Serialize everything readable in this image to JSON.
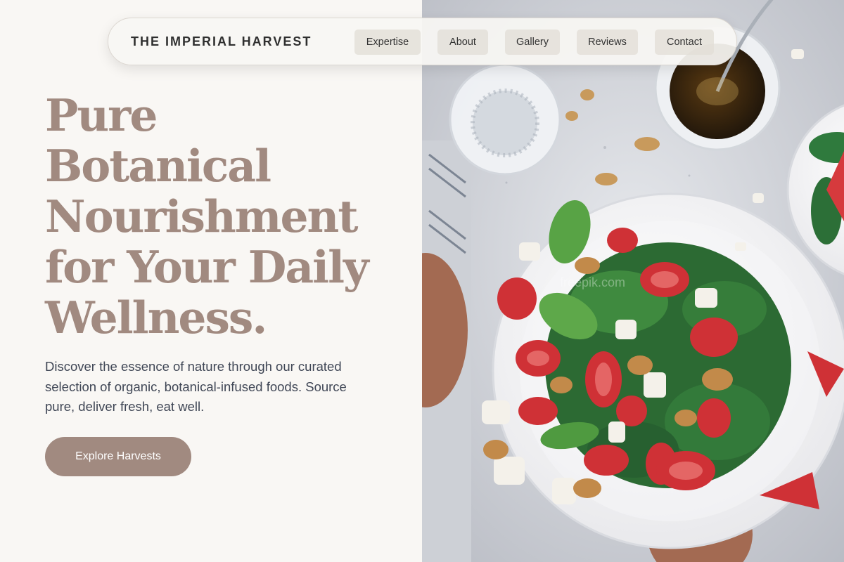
{
  "brand": "THE IMPERIAL HARVEST",
  "nav": {
    "links": [
      "Expertise",
      "About",
      "Gallery",
      "Reviews",
      "Contact"
    ]
  },
  "hero": {
    "headline_lines": [
      "Pure",
      "Botanical",
      "Nourishment",
      "for Your Daily",
      "Wellness."
    ],
    "subtext": "Discover the essence of nature through our curated selection of organic, botanical-infused foods. Source pure, deliver fresh, eat well.",
    "cta_label": "Explore Harvests"
  },
  "photo": {
    "watermark": "freepik.com"
  },
  "colors": {
    "background": "#f9f7f4",
    "accent": "#a18a80",
    "text_dark": "#2f2f2f",
    "body_text": "#3f4655",
    "nav_pill": "#e2ddd6"
  }
}
